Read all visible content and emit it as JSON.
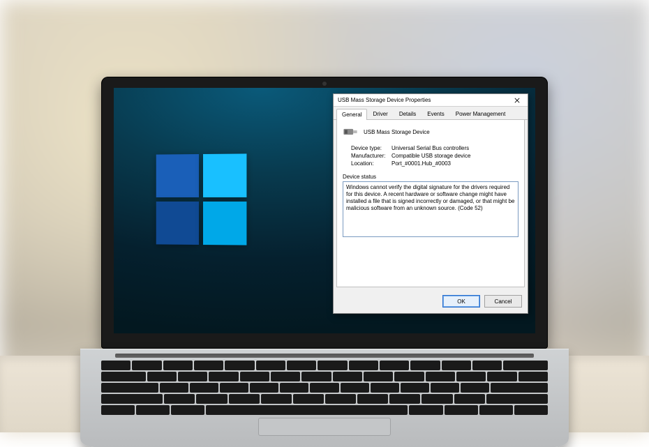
{
  "dialog": {
    "title": "USB Mass Storage Device Properties",
    "tabs": {
      "general": "General",
      "driver": "Driver",
      "details": "Details",
      "events": "Events",
      "power": "Power Management"
    },
    "device_name": "USB Mass Storage Device",
    "props": {
      "device_type_label": "Device type:",
      "device_type": "Universal Serial Bus controllers",
      "manufacturer_label": "Manufacturer:",
      "manufacturer": "Compatible USB storage device",
      "location_label": "Location:",
      "location": "Port_#0001.Hub_#0003"
    },
    "status_label": "Device status",
    "status_text": "Windows cannot verify the digital signature for the drivers required for this device. A recent hardware or software change might have installed a file that is signed incorrectly or damaged, or that might be malicious software from an unknown source. (Code 52)",
    "buttons": {
      "ok": "OK",
      "cancel": "Cancel"
    }
  }
}
